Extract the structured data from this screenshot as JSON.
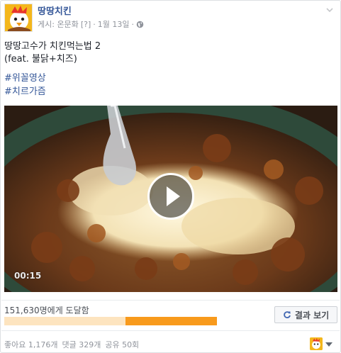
{
  "post": {
    "page_name": "땅땅치킨",
    "meta": {
      "posted_by_label": "게시: 온문화",
      "help_marker": "[?]",
      "separator": "·",
      "date": "1월 13일",
      "separator2": "·",
      "audience_icon": "globe-icon"
    },
    "text_lines": [
      "땅땅고수가 치킨먹는법 2",
      "(feat. 불닭+치즈)"
    ],
    "hashtags": [
      "#위꼴영상",
      "#치르가즘"
    ],
    "video": {
      "duration": "00:15",
      "play_icon": "play-icon"
    },
    "reach": {
      "label": "151,630명에게 도달함",
      "progress_fraction": 0.57,
      "results_button": "결과 보기",
      "results_icon": "refresh-icon"
    },
    "stats": {
      "likes": "좋아요 1,176개",
      "comments": "댓글 329개",
      "shares": "공유 50회"
    },
    "colors": {
      "link": "#365899",
      "progress": "#f89a1c",
      "progress_light": "#fde4bf"
    }
  }
}
